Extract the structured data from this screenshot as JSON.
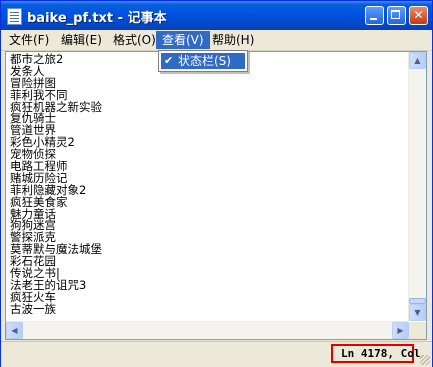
{
  "window": {
    "title": "baike_pf.txt - 记事本",
    "buttons": {
      "minimize_icon": "minimize-icon",
      "maximize_icon": "maximize-icon",
      "close_glyph": "✕"
    }
  },
  "menu": [
    {
      "label": "文件(F)"
    },
    {
      "label": "编辑(E)"
    },
    {
      "label": "格式(O)"
    },
    {
      "label": "查看(V)"
    },
    {
      "label": "帮助(H)"
    }
  ],
  "view_menu": {
    "items": [
      {
        "check": "✔",
        "label": "状态栏(S)",
        "checked": true
      }
    ]
  },
  "editor": {
    "lines": [
      "都市之旅2",
      "发条人",
      "冒险拼图",
      "菲利我不同",
      "疯狂机器之新实验",
      "复仇骑士",
      "管道世界",
      "彩色小精灵2",
      "宠物侦探",
      "电路工程师",
      "赌城历险记",
      "菲利隐藏对象2",
      "疯狂美食家",
      "魅力童话",
      "狗狗迷宫",
      "警探派克",
      "莫蒂默与魔法城堡",
      "彩石花园",
      "传说之书|",
      "法老王的诅咒3",
      "疯狂火车",
      "古波一族"
    ]
  },
  "scrollbars": {
    "up_glyph": "▲",
    "down_glyph": "▼",
    "left_glyph": "◀",
    "right_glyph": "▶"
  },
  "status": {
    "text": "Ln 4178, Col",
    "highlight_color": "#e00000"
  },
  "colors": {
    "titlebar": "#0054e3",
    "menu_highlight": "#316ac5",
    "window_bg": "#ece9d8"
  }
}
